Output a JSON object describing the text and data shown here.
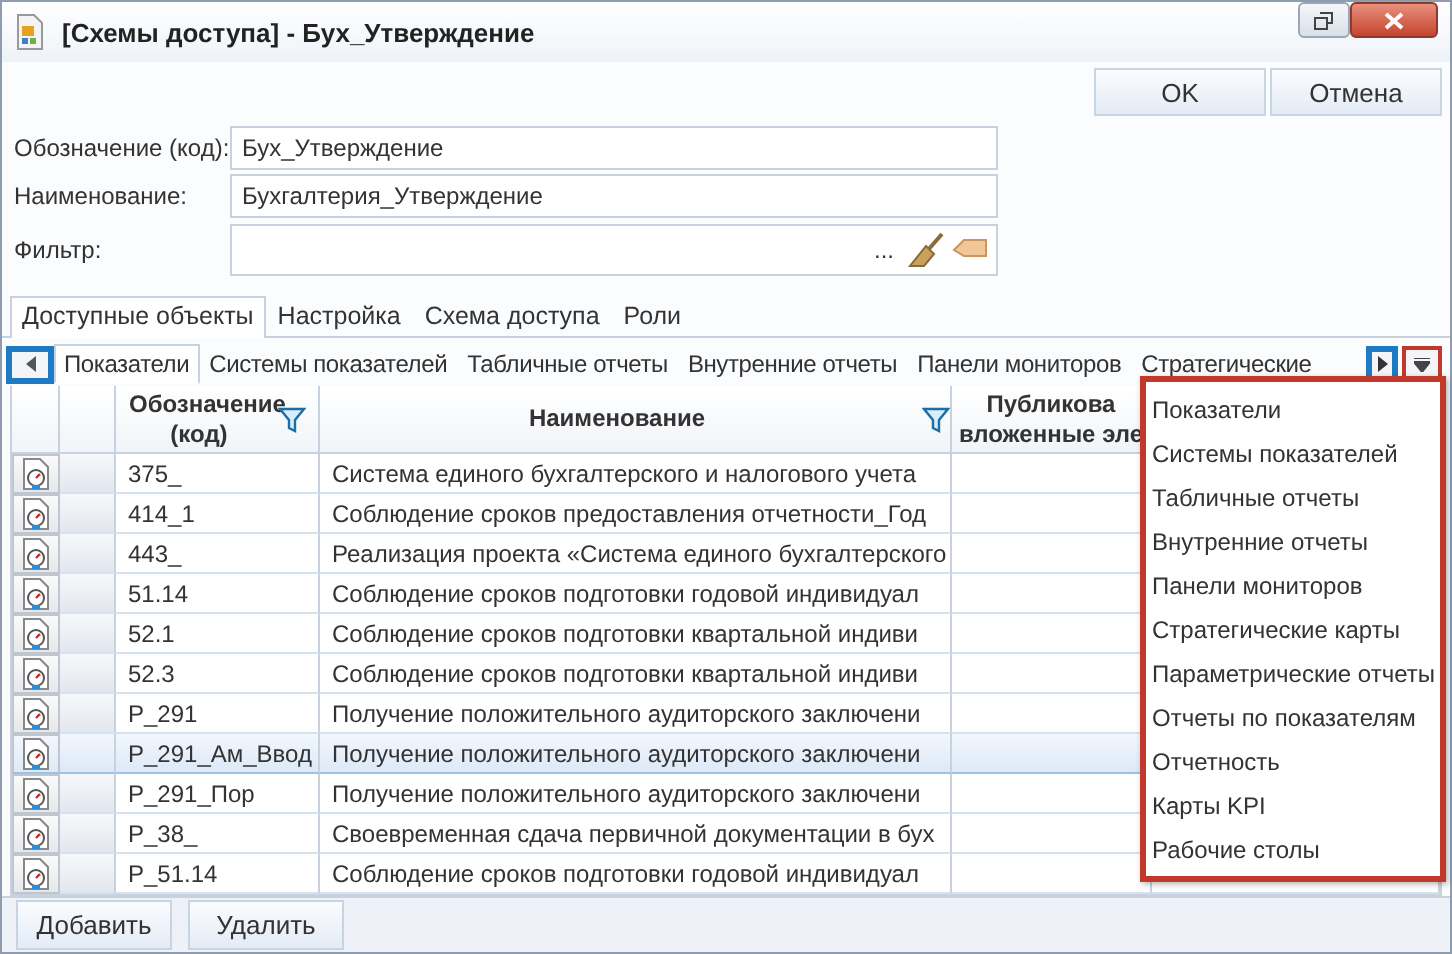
{
  "window": {
    "title": "[Схемы доступа] - Бух_Утверждение"
  },
  "actions": [
    "OK",
    "Отмена"
  ],
  "fields": [
    {
      "kind": "text",
      "label": "Обозначение (код):",
      "value": "Бух_Утверждение"
    },
    {
      "kind": "text",
      "label": "Наименование:",
      "value": "Бухгалтерия_Утверждение"
    },
    {
      "kind": "filter",
      "label": "Фильтр:",
      "button": "..."
    }
  ],
  "tabs": [
    {
      "label": "Доступные объекты",
      "selected": true
    },
    {
      "label": "Настройка",
      "selected": false
    },
    {
      "label": "Схема доступа",
      "selected": false
    },
    {
      "label": "Роли",
      "selected": false
    }
  ],
  "object_tabs": [
    {
      "label": "Показатели",
      "selected": true
    },
    {
      "label": "Системы показателей",
      "selected": false
    },
    {
      "label": "Табличные отчеты",
      "selected": false
    },
    {
      "label": "Внутренние отчеты",
      "selected": false
    },
    {
      "label": "Панели мониторов",
      "selected": false
    },
    {
      "label": "Стратегические",
      "selected": false
    }
  ],
  "table": {
    "columns": [
      {
        "title": "Обозначение (код)",
        "filter": true
      },
      {
        "title": "Наименование",
        "filter": true
      },
      {
        "title": "Публикова вложенные эле",
        "filter": false
      }
    ],
    "rows": [
      {
        "code": "375_",
        "name": "Система единого бухгалтерского и налогового учета",
        "selected": false
      },
      {
        "code": "414_1",
        "name": "Соблюдение сроков предоставления отчетности_Год",
        "selected": false
      },
      {
        "code": "443_",
        "name": "Реализация проекта «Система единого бухгалтерского",
        "selected": false
      },
      {
        "code": "51.14",
        "name": "Соблюдение сроков подготовки годовой индивидуал",
        "selected": false
      },
      {
        "code": "52.1",
        "name": "Соблюдение сроков подготовки квартальной индиви",
        "selected": false
      },
      {
        "code": "52.3",
        "name": "Соблюдение сроков подготовки квартальной индиви",
        "selected": false
      },
      {
        "code": "P_291",
        "name": "Получение положительного аудиторского заключени",
        "selected": false
      },
      {
        "code": "P_291_Ам_Ввод",
        "name": "Получение положительного аудиторского заключени",
        "selected": true
      },
      {
        "code": "P_291_Пор",
        "name": "Получение положительного аудиторского заключени",
        "selected": false
      },
      {
        "code": "P_38_",
        "name": "Своевременная сдача первичной документации в бух",
        "selected": false
      },
      {
        "code": "P_51.14",
        "name": "Соблюдение сроков подготовки годовой индивидуал",
        "selected": false
      }
    ]
  },
  "menu": {
    "items": [
      "Показатели",
      "Системы показателей",
      "Табличные отчеты",
      "Внутренние отчеты",
      "Панели мониторов",
      "Стратегические карты",
      "Параметрические отчеты",
      "Отчеты по показателям",
      "Отчетность",
      "Карты KPI",
      "Рабочие столы"
    ]
  },
  "buttons": [
    "Добавить",
    "Удалить"
  ]
}
